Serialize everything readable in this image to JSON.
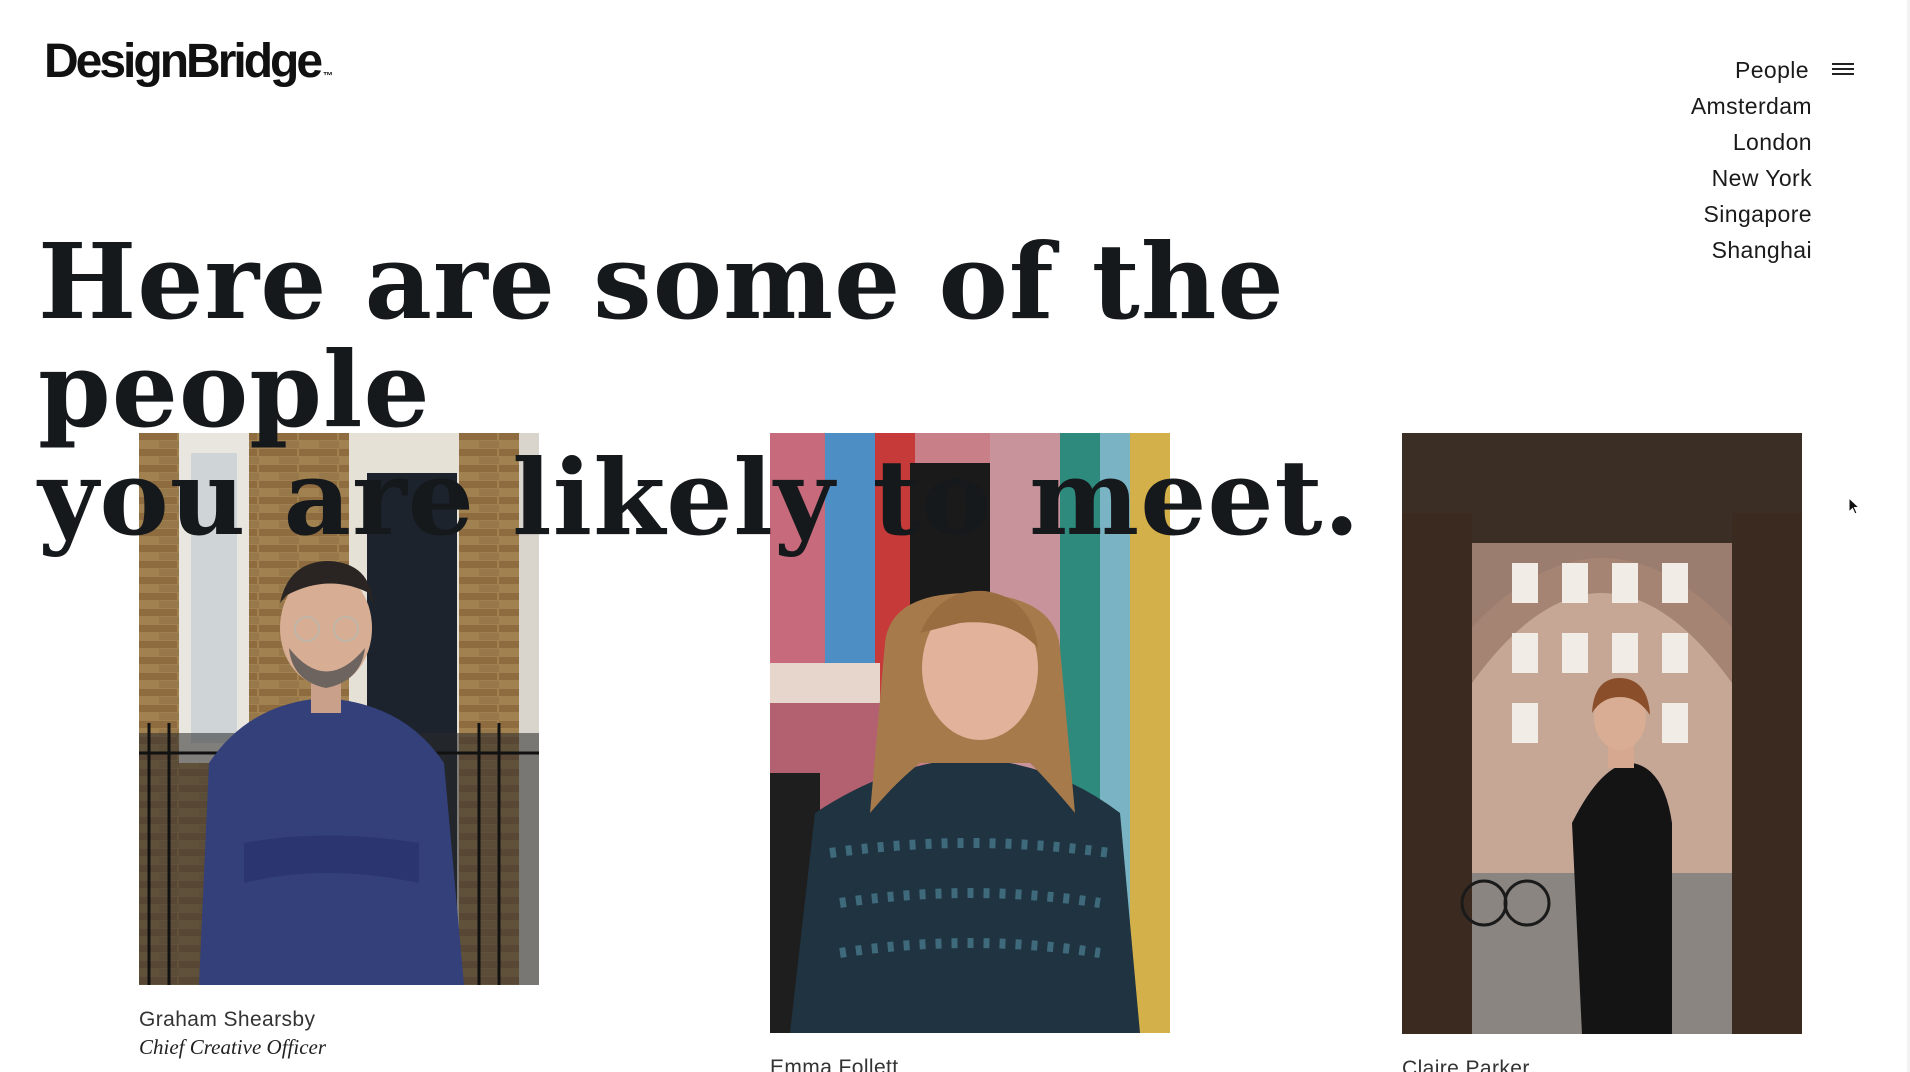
{
  "brand": {
    "logo_text": "DesignBridge",
    "trademark": "TM"
  },
  "nav": {
    "current": "People",
    "menu_icon": "hamburger-menu-icon",
    "locations": [
      "Amsterdam",
      "London",
      "New York",
      "Singapore",
      "Shanghai"
    ]
  },
  "headline": {
    "line1": "Here are some of the people",
    "line2": "you are likely to meet."
  },
  "people": [
    {
      "name": "Graham Shearsby",
      "role": "Chief Creative Officer"
    },
    {
      "name": "Emma Follett",
      "role": ""
    },
    {
      "name": "Claire Parker",
      "role": ""
    }
  ],
  "colors": {
    "text": "#16191c",
    "background": "#ffffff"
  }
}
